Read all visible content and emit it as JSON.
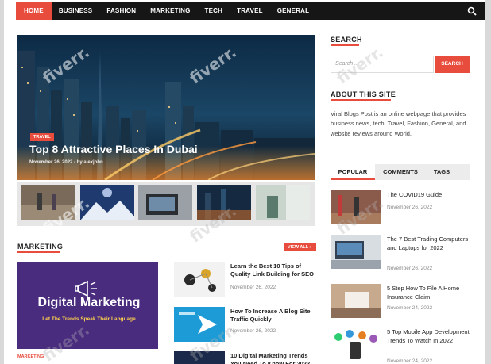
{
  "nav": {
    "items": [
      "HOME",
      "BUSINESS",
      "FASHION",
      "MARKETING",
      "TECH",
      "TRAVEL",
      "GENERAL"
    ],
    "active": "HOME",
    "search_icon": "search-icon"
  },
  "hero": {
    "category": "TRAVEL",
    "title": "Top 8 Attractive Places In Dubai",
    "meta": "November 26, 2022 - by alexjohn"
  },
  "marketing": {
    "title": "MARKETING",
    "view_all": "VIEW ALL »",
    "featured": {
      "image_title": "Digital Marketing",
      "image_subtitle": "Let The Trends Speak Their Language",
      "category": "MARKETING"
    },
    "posts": [
      {
        "title": "Learn the Best 10 Tips of Quality Link Building for SEO",
        "date": "November 26, 2022"
      },
      {
        "title": "How To Increase A Blog Site Traffic Quickly",
        "date": "November 26, 2022"
      },
      {
        "title": "10 Digital Marketing Trends You Need To Know For 2022",
        "date": ""
      }
    ]
  },
  "sidebar": {
    "search_title": "SEARCH",
    "search_placeholder": "Search ...",
    "search_button": "SEARCH",
    "about_title": "ABOUT THIS SITE",
    "about_text": "Viral Blogs Post is an online webpage that provides business news, tech, Travel, Fashion, General, and website reviews around World.",
    "tabs": [
      "POPULAR",
      "COMMENTS",
      "TAGS"
    ],
    "active_tab": "POPULAR",
    "popular": [
      {
        "title": "The COVID19 Guide",
        "date": "November 26, 2022"
      },
      {
        "title": "The 7 Best Trading Computers and Laptops for 2022",
        "date": "November 26, 2022"
      },
      {
        "title": "5 Step How To File A Home Insurance Claim",
        "date": "November 24, 2022"
      },
      {
        "title": "5 Top Mobile App Development Trends To Watch In 2022",
        "date": "November 24, 2022"
      }
    ]
  },
  "watermark": "fiverr.",
  "colors": {
    "accent": "#e74c3c",
    "nav_bg": "#161616",
    "purple": "#4a2c7e"
  }
}
